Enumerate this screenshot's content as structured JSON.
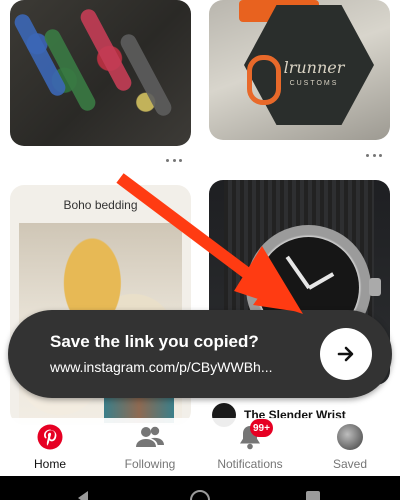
{
  "feed": {
    "pins": [
      {
        "name": "knives-collection",
        "title": ""
      },
      {
        "name": "runner-customs-patch",
        "title": "",
        "patch_text": "lrunner",
        "patch_sub": "CUSTOMS"
      },
      {
        "name": "boho-bedding",
        "title": "Boho bedding"
      },
      {
        "name": "watch",
        "title": "",
        "author": "The Slender Wrist"
      }
    ]
  },
  "toast": {
    "title": "Save the link you copied?",
    "url": "www.instagram.com/p/CByWWBh...",
    "action_icon": "arrow-right-icon"
  },
  "tabbar": {
    "tabs": [
      {
        "label": "Home",
        "icon": "pinterest-logo-icon",
        "active": true
      },
      {
        "label": "Following",
        "icon": "people-icon",
        "active": false
      },
      {
        "label": "Notifications",
        "icon": "bell-icon",
        "active": false
      },
      {
        "label": "Saved",
        "icon": "profile-avatar-icon",
        "active": false
      }
    ],
    "notifications_badge": "99+"
  },
  "colors": {
    "brand": "#E60023",
    "toast_bg": "#333333",
    "annotation_arrow": "#FF3B12"
  }
}
